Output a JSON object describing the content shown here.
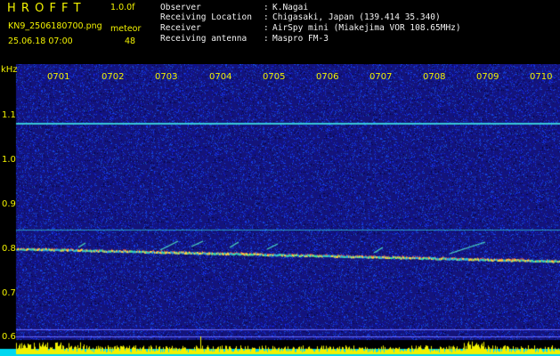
{
  "header": {
    "title": "H R O F F T",
    "version": "1.0.0f",
    "filename": "KN9_2506180700.png",
    "datetime": "25.06.18 07:00",
    "counter_label": "meteor",
    "counter_value": "48"
  },
  "info": {
    "rows": [
      {
        "label": "Observer",
        "value": "K.Nagai"
      },
      {
        "label": "Receiving Location",
        "value": "Chigasaki, Japan (139.414 35.340)"
      },
      {
        "label": "Receiver",
        "value": "AirSpy mini (Miakejima VOR 108.65MHz)"
      },
      {
        "label": "Receiving antenna",
        "value": "Maspro FM-3"
      }
    ]
  },
  "spectrogram": {
    "y_unit": "kHz",
    "y_ticks": [
      "1.1",
      "1.0",
      "0.9",
      "0.8",
      "0.7",
      "0.6"
    ],
    "x_ticks": [
      "0701",
      "0702",
      "0703",
      "0704",
      "0705",
      "0706",
      "0707",
      "0708",
      "0709",
      "0710"
    ],
    "colors": {
      "background": "#14147a",
      "label": "#f2f200",
      "level_bar": "#f2f200",
      "level_base": "#00d8f0"
    }
  }
}
